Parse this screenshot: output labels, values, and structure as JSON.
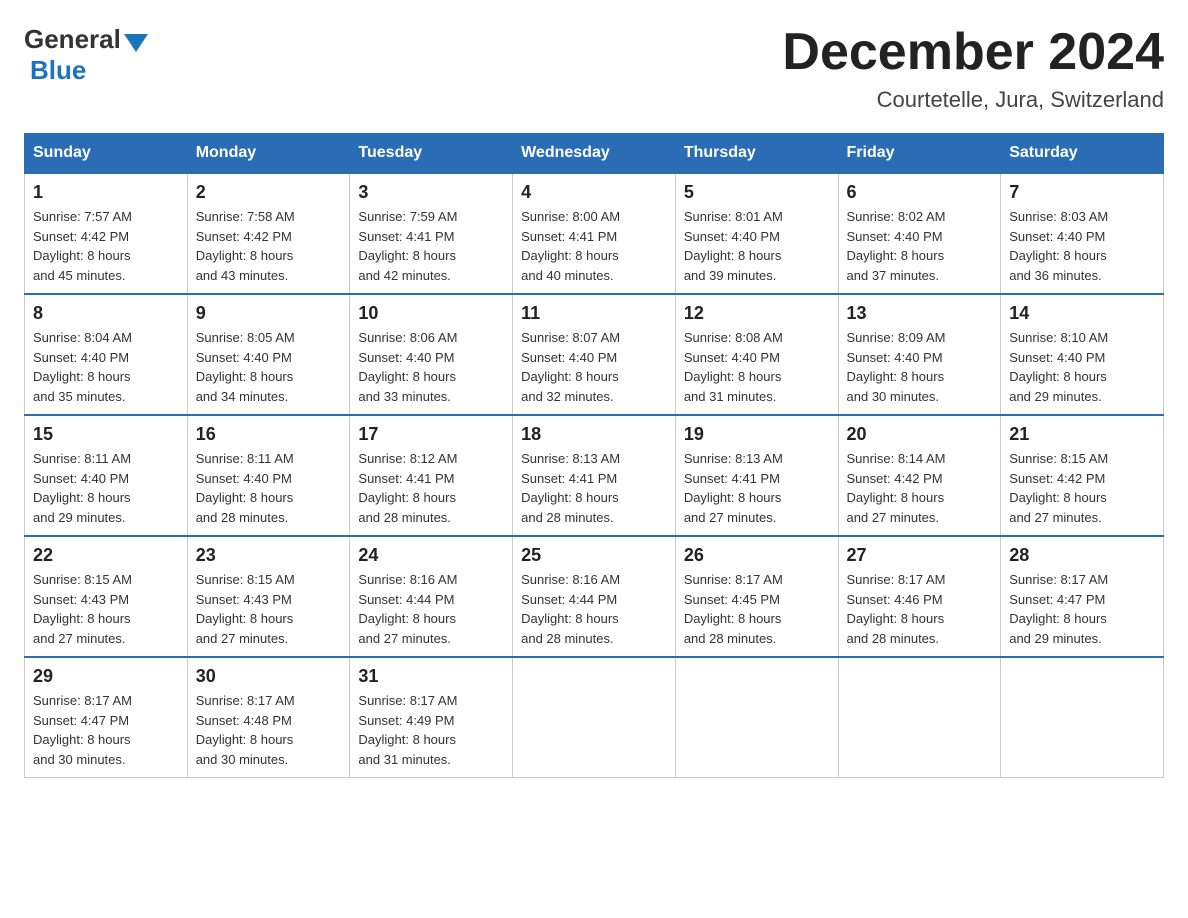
{
  "logo": {
    "general": "General",
    "blue": "Blue"
  },
  "title": "December 2024",
  "subtitle": "Courtetelle, Jura, Switzerland",
  "headers": [
    "Sunday",
    "Monday",
    "Tuesday",
    "Wednesday",
    "Thursday",
    "Friday",
    "Saturday"
  ],
  "weeks": [
    [
      {
        "day": "1",
        "sunrise": "7:57 AM",
        "sunset": "4:42 PM",
        "daylight": "8 hours and 45 minutes."
      },
      {
        "day": "2",
        "sunrise": "7:58 AM",
        "sunset": "4:42 PM",
        "daylight": "8 hours and 43 minutes."
      },
      {
        "day": "3",
        "sunrise": "7:59 AM",
        "sunset": "4:41 PM",
        "daylight": "8 hours and 42 minutes."
      },
      {
        "day": "4",
        "sunrise": "8:00 AM",
        "sunset": "4:41 PM",
        "daylight": "8 hours and 40 minutes."
      },
      {
        "day": "5",
        "sunrise": "8:01 AM",
        "sunset": "4:40 PM",
        "daylight": "8 hours and 39 minutes."
      },
      {
        "day": "6",
        "sunrise": "8:02 AM",
        "sunset": "4:40 PM",
        "daylight": "8 hours and 37 minutes."
      },
      {
        "day": "7",
        "sunrise": "8:03 AM",
        "sunset": "4:40 PM",
        "daylight": "8 hours and 36 minutes."
      }
    ],
    [
      {
        "day": "8",
        "sunrise": "8:04 AM",
        "sunset": "4:40 PM",
        "daylight": "8 hours and 35 minutes."
      },
      {
        "day": "9",
        "sunrise": "8:05 AM",
        "sunset": "4:40 PM",
        "daylight": "8 hours and 34 minutes."
      },
      {
        "day": "10",
        "sunrise": "8:06 AM",
        "sunset": "4:40 PM",
        "daylight": "8 hours and 33 minutes."
      },
      {
        "day": "11",
        "sunrise": "8:07 AM",
        "sunset": "4:40 PM",
        "daylight": "8 hours and 32 minutes."
      },
      {
        "day": "12",
        "sunrise": "8:08 AM",
        "sunset": "4:40 PM",
        "daylight": "8 hours and 31 minutes."
      },
      {
        "day": "13",
        "sunrise": "8:09 AM",
        "sunset": "4:40 PM",
        "daylight": "8 hours and 30 minutes."
      },
      {
        "day": "14",
        "sunrise": "8:10 AM",
        "sunset": "4:40 PM",
        "daylight": "8 hours and 29 minutes."
      }
    ],
    [
      {
        "day": "15",
        "sunrise": "8:11 AM",
        "sunset": "4:40 PM",
        "daylight": "8 hours and 29 minutes."
      },
      {
        "day": "16",
        "sunrise": "8:11 AM",
        "sunset": "4:40 PM",
        "daylight": "8 hours and 28 minutes."
      },
      {
        "day": "17",
        "sunrise": "8:12 AM",
        "sunset": "4:41 PM",
        "daylight": "8 hours and 28 minutes."
      },
      {
        "day": "18",
        "sunrise": "8:13 AM",
        "sunset": "4:41 PM",
        "daylight": "8 hours and 28 minutes."
      },
      {
        "day": "19",
        "sunrise": "8:13 AM",
        "sunset": "4:41 PM",
        "daylight": "8 hours and 27 minutes."
      },
      {
        "day": "20",
        "sunrise": "8:14 AM",
        "sunset": "4:42 PM",
        "daylight": "8 hours and 27 minutes."
      },
      {
        "day": "21",
        "sunrise": "8:15 AM",
        "sunset": "4:42 PM",
        "daylight": "8 hours and 27 minutes."
      }
    ],
    [
      {
        "day": "22",
        "sunrise": "8:15 AM",
        "sunset": "4:43 PM",
        "daylight": "8 hours and 27 minutes."
      },
      {
        "day": "23",
        "sunrise": "8:15 AM",
        "sunset": "4:43 PM",
        "daylight": "8 hours and 27 minutes."
      },
      {
        "day": "24",
        "sunrise": "8:16 AM",
        "sunset": "4:44 PM",
        "daylight": "8 hours and 27 minutes."
      },
      {
        "day": "25",
        "sunrise": "8:16 AM",
        "sunset": "4:44 PM",
        "daylight": "8 hours and 28 minutes."
      },
      {
        "day": "26",
        "sunrise": "8:17 AM",
        "sunset": "4:45 PM",
        "daylight": "8 hours and 28 minutes."
      },
      {
        "day": "27",
        "sunrise": "8:17 AM",
        "sunset": "4:46 PM",
        "daylight": "8 hours and 28 minutes."
      },
      {
        "day": "28",
        "sunrise": "8:17 AM",
        "sunset": "4:47 PM",
        "daylight": "8 hours and 29 minutes."
      }
    ],
    [
      {
        "day": "29",
        "sunrise": "8:17 AM",
        "sunset": "4:47 PM",
        "daylight": "8 hours and 30 minutes."
      },
      {
        "day": "30",
        "sunrise": "8:17 AM",
        "sunset": "4:48 PM",
        "daylight": "8 hours and 30 minutes."
      },
      {
        "day": "31",
        "sunrise": "8:17 AM",
        "sunset": "4:49 PM",
        "daylight": "8 hours and 31 minutes."
      },
      null,
      null,
      null,
      null
    ]
  ],
  "labels": {
    "sunrise": "Sunrise:",
    "sunset": "Sunset:",
    "daylight": "Daylight:"
  }
}
